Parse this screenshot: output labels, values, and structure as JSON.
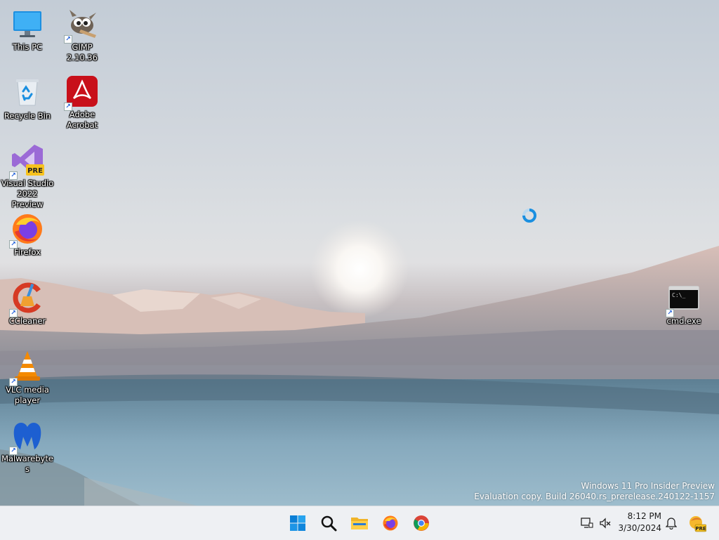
{
  "desktop": {
    "icons": [
      {
        "name": "This PC",
        "icon": "monitor-icon"
      },
      {
        "name": "GIMP 2.10.36",
        "icon": "gimp-icon"
      },
      {
        "name": "Recycle Bin",
        "icon": "recycle-bin-icon"
      },
      {
        "name": "Adobe Acrobat",
        "icon": "acrobat-icon"
      },
      {
        "name": "Visual Studio 2022 Preview",
        "icon": "visual-studio-icon",
        "badge": "PRE"
      },
      {
        "name": "Firefox",
        "icon": "firefox-icon"
      },
      {
        "name": "CCleaner",
        "icon": "ccleaner-icon"
      },
      {
        "name": "VLC media player",
        "icon": "vlc-icon"
      },
      {
        "name": "Malwarebytes",
        "icon": "malwarebytes-icon"
      },
      {
        "name": "cmd.exe",
        "icon": "cmd-icon",
        "text": "C:\\_"
      }
    ],
    "watermark": {
      "line1": "Windows 11 Pro Insider Preview",
      "line2": "Evaluation copy. Build 26040.rs_prerelease.240122-1157"
    }
  },
  "taskbar": {
    "apps": [
      {
        "name": "Start",
        "icon": "windows-start-icon"
      },
      {
        "name": "Search",
        "icon": "search-icon"
      },
      {
        "name": "File Explorer",
        "icon": "file-explorer-icon"
      },
      {
        "name": "Firefox",
        "icon": "firefox-icon"
      },
      {
        "name": "Google Chrome",
        "icon": "chrome-icon"
      }
    ],
    "tray": {
      "time": "8:12 PM",
      "date": "3/30/2024",
      "icons": [
        "network-icon",
        "volume-muted-icon",
        "notification-bell-icon",
        "copilot-pre-icon"
      ],
      "pre_badge": "PRE"
    }
  },
  "colors": {
    "accent": "#0067c0",
    "taskbar": "#eef0f3"
  }
}
